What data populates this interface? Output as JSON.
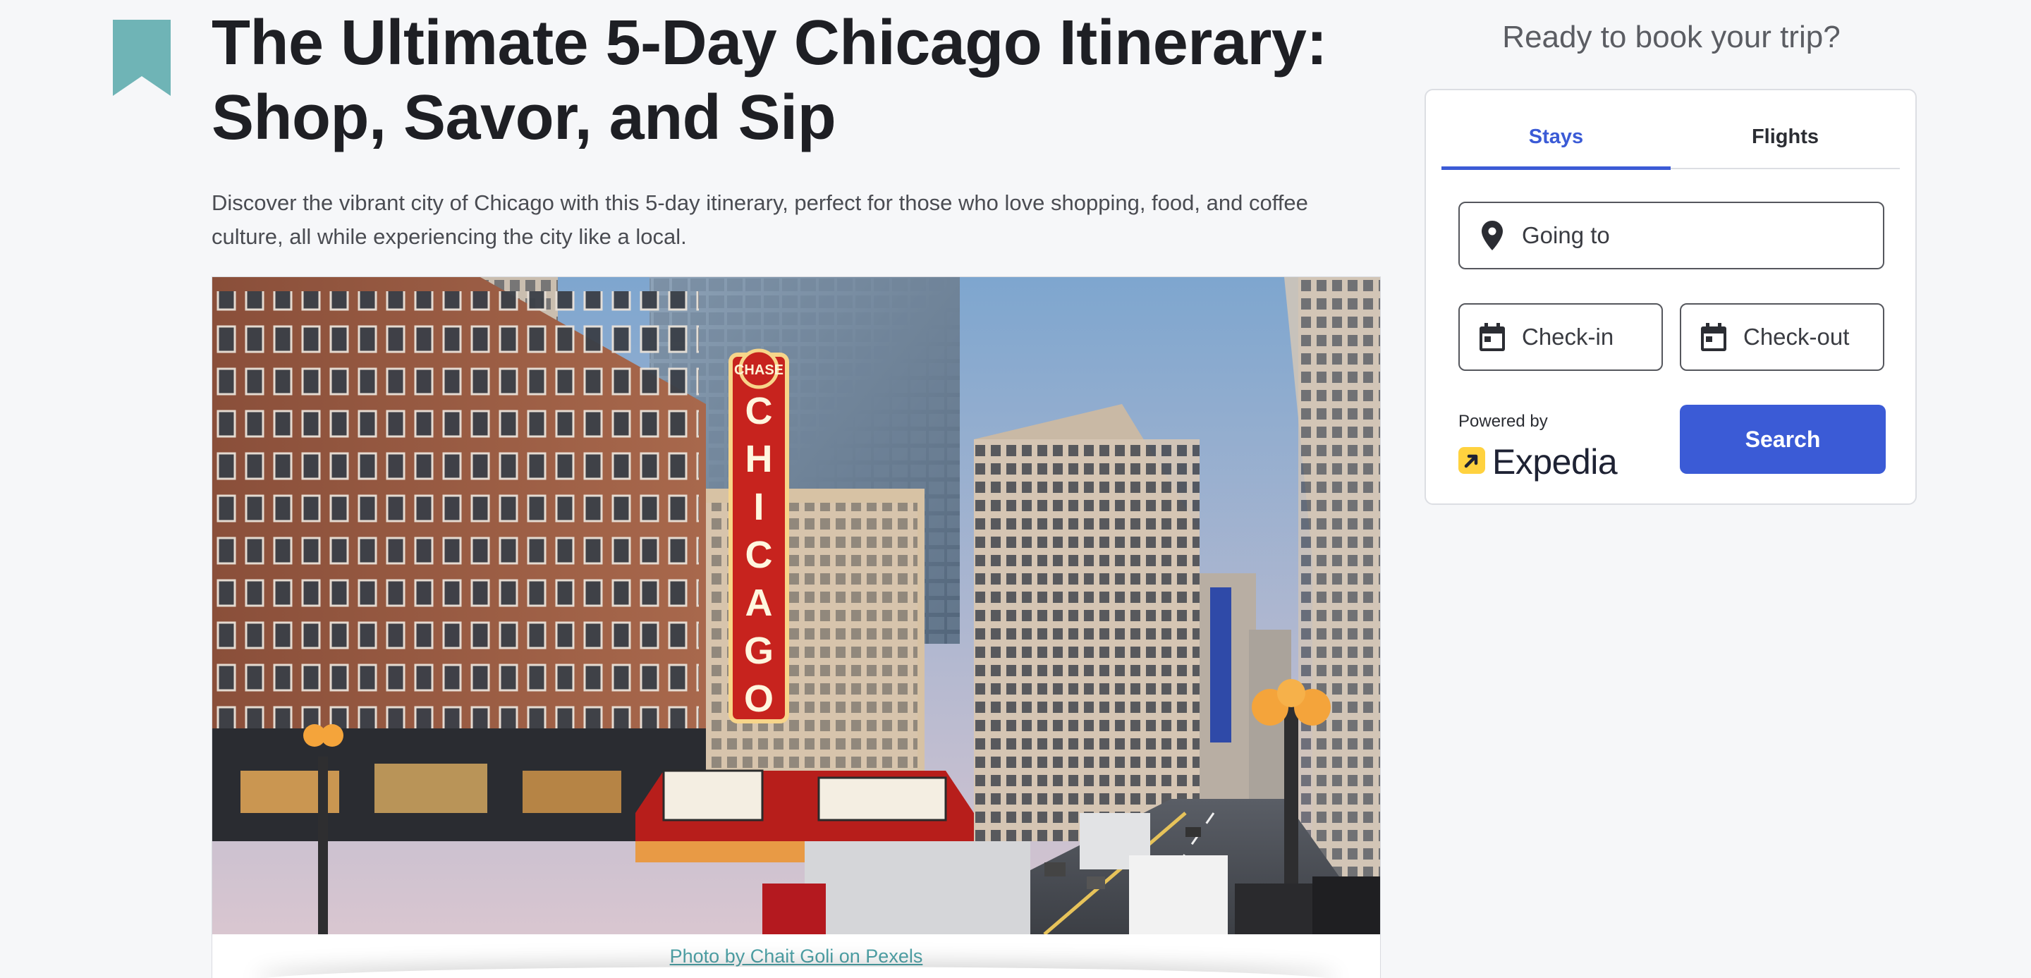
{
  "article": {
    "title": "The Ultimate 5-Day Chicago Itinerary: Shop, Savor, and Sip",
    "description": "Discover the vibrant city of Chicago with this 5-day itinerary, perfect for those who love shopping, food, and coffee culture, all while experiencing the city like a local.",
    "photo_caption": "Photo by Chait Goli on Pexels",
    "photo_sign_text": "CHICAGO",
    "photo_sign_top": "CHASE"
  },
  "booking": {
    "heading": "Ready to book your trip?",
    "tabs": [
      {
        "label": "Stays",
        "active": true
      },
      {
        "label": "Flights",
        "active": false
      }
    ],
    "destination_placeholder": "Going to",
    "checkin_label": "Check-in",
    "checkout_label": "Check-out",
    "powered_by": "Powered by",
    "brand": "Expedia",
    "search_label": "Search"
  },
  "icons": {
    "bookmark": "bookmark-icon",
    "location": "location-pin-icon",
    "calendar": "calendar-icon",
    "brand_logo": "expedia-logo-icon"
  },
  "colors": {
    "accent": "#3b5bd6",
    "bookmark": "#6fb4b6",
    "caption_link": "#4fa3a8",
    "expedia_yellow": "#ffd23f"
  }
}
